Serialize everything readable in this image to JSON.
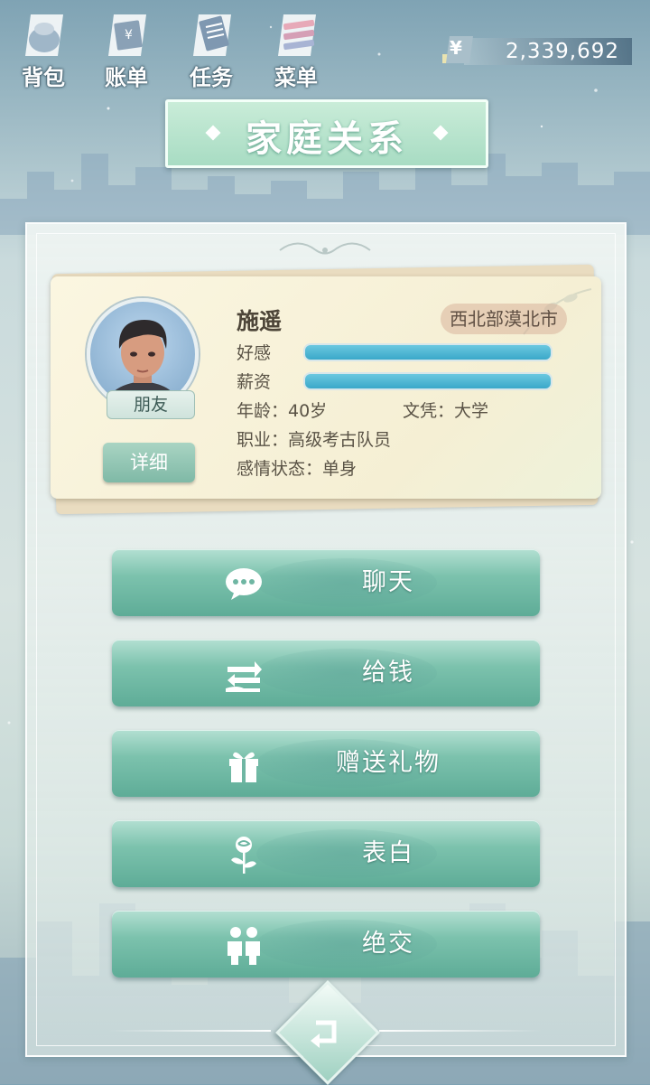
{
  "topbar": {
    "items": [
      {
        "label": "背包",
        "icon": "backpack-icon"
      },
      {
        "label": "账单",
        "icon": "bill-icon"
      },
      {
        "label": "任务",
        "icon": "task-icon"
      },
      {
        "label": "菜单",
        "icon": "menu-icon"
      }
    ],
    "money": {
      "currency_symbol": "¥",
      "value": "2,339,692"
    }
  },
  "title": "家庭关系",
  "card": {
    "name": "施遥",
    "region": "西北部漠北市",
    "relation": "朋友",
    "detail_button": "详细",
    "stats": [
      {
        "label": "好感",
        "fill": 1.0
      },
      {
        "label": "薪资",
        "fill": 1.0
      }
    ],
    "age_label": "年龄：40岁",
    "education_label": "文凭：大学",
    "job_label": "职业：高级考古队员",
    "relationship_label": "感情状态：单身"
  },
  "actions": [
    {
      "label": "聊天",
      "icon": "chat-icon"
    },
    {
      "label": "给钱",
      "icon": "give-money-icon"
    },
    {
      "label": "赠送礼物",
      "icon": "gift-icon"
    },
    {
      "label": "表白",
      "icon": "rose-icon"
    },
    {
      "label": "绝交",
      "icon": "friends-icon"
    }
  ],
  "back_icon": "back-arrow-icon",
  "colors": {
    "accent": "#7cc2ad",
    "bar": "#3aa8c9",
    "card": "#f8f2da"
  }
}
